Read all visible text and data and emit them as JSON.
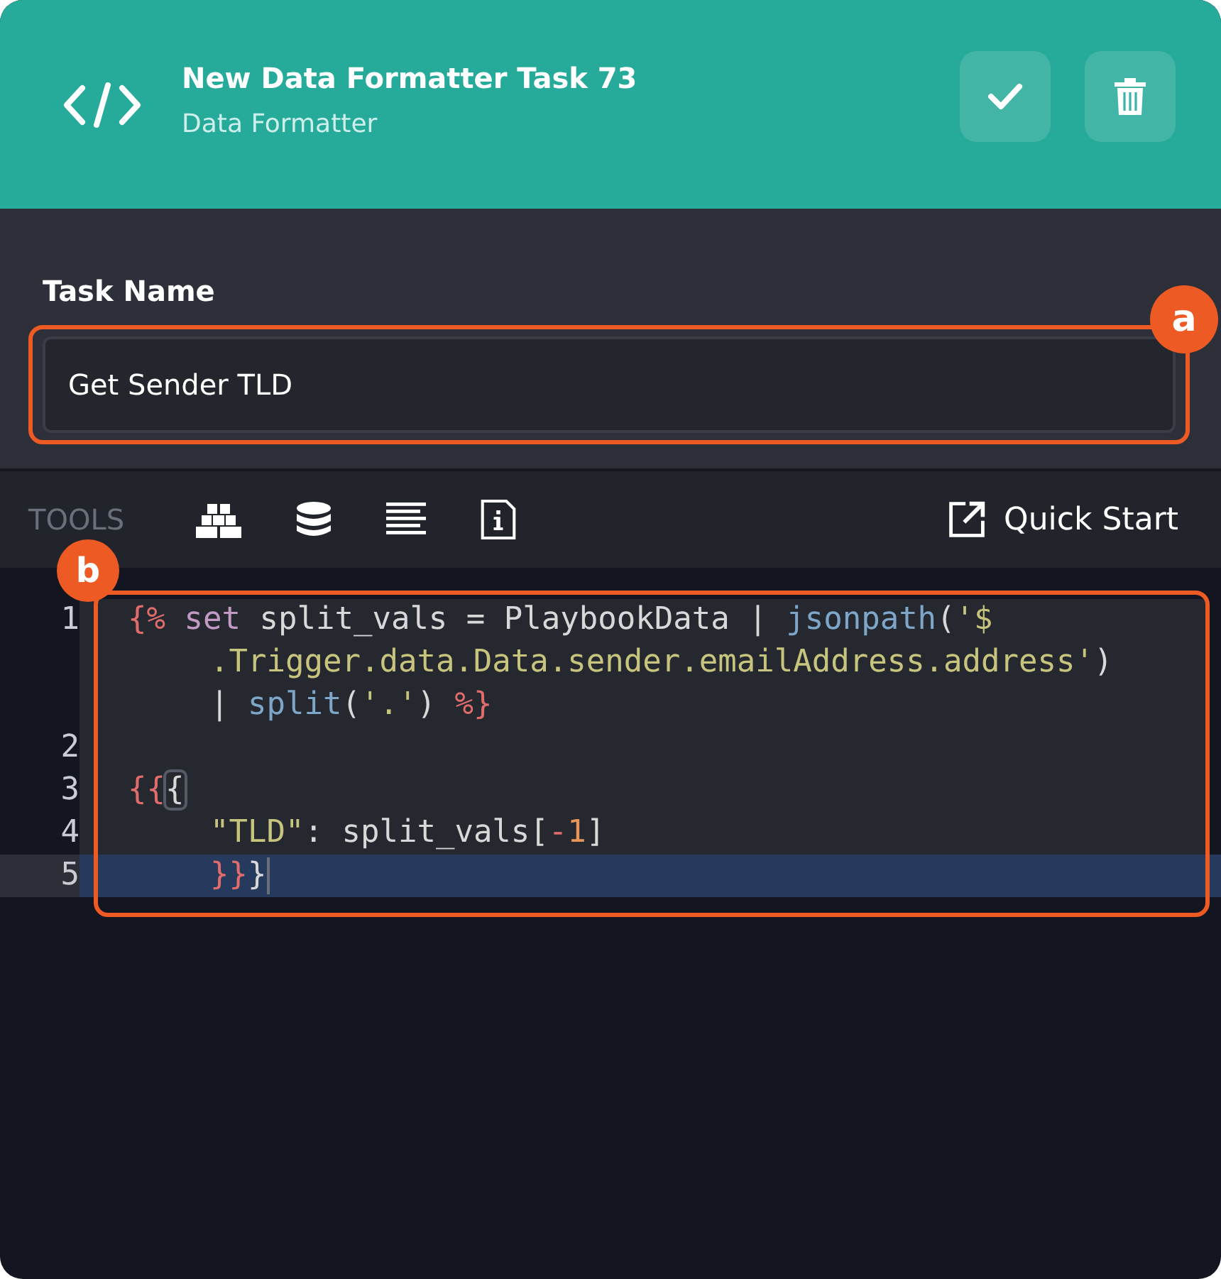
{
  "header": {
    "title": "New Data Formatter Task 73",
    "subtitle": "Data Formatter"
  },
  "task_name": {
    "label": "Task Name",
    "value": "Get Sender TLD",
    "badge": "a"
  },
  "toolbar": {
    "label": "TOOLS",
    "quick_start": "Quick Start"
  },
  "editor": {
    "badge": "b",
    "lines": [
      {
        "number": "1",
        "active": false,
        "rows": [
          {
            "tokens": [
              {
                "kind": "delim",
                "text": "{%"
              },
              {
                "kind": "keyword",
                "text": " set"
              },
              {
                "kind": "text",
                "text": " split_vals = PlaybookData | "
              },
              {
                "kind": "func",
                "text": "jsonpath"
              },
              {
                "kind": "text",
                "text": "("
              },
              {
                "kind": "string",
                "text": "'$"
              }
            ]
          },
          {
            "tokens": [
              {
                "kind": "string",
                "text": ".Trigger.data.Data.sender.emailAddress.address'"
              },
              {
                "kind": "text",
                "text": ")"
              }
            ]
          },
          {
            "tokens": [
              {
                "kind": "text",
                "text": "| "
              },
              {
                "kind": "func",
                "text": "split"
              },
              {
                "kind": "text",
                "text": "("
              },
              {
                "kind": "string",
                "text": "'.'"
              },
              {
                "kind": "text",
                "text": ") "
              },
              {
                "kind": "delim",
                "text": "%}"
              }
            ]
          }
        ]
      },
      {
        "number": "2",
        "active": false
      },
      {
        "number": "3",
        "active": false,
        "rows": [
          {
            "tokens": [
              {
                "kind": "delim",
                "text": "{{"
              },
              {
                "kind": "match",
                "text": "{"
              }
            ]
          }
        ]
      },
      {
        "number": "4",
        "active": false,
        "rows": [
          {
            "indent": true,
            "tokens": [
              {
                "kind": "string",
                "text": "\"TLD\""
              },
              {
                "kind": "text",
                "text": ": split_vals["
              },
              {
                "kind": "delim",
                "text": "-"
              },
              {
                "kind": "number",
                "text": "1"
              },
              {
                "kind": "text",
                "text": "]"
              }
            ]
          }
        ]
      },
      {
        "number": "5",
        "active": true,
        "rows": [
          {
            "indent": true,
            "tokens": [
              {
                "kind": "delim",
                "text": "}}"
              },
              {
                "kind": "text",
                "text": "}"
              }
            ]
          }
        ]
      }
    ]
  }
}
